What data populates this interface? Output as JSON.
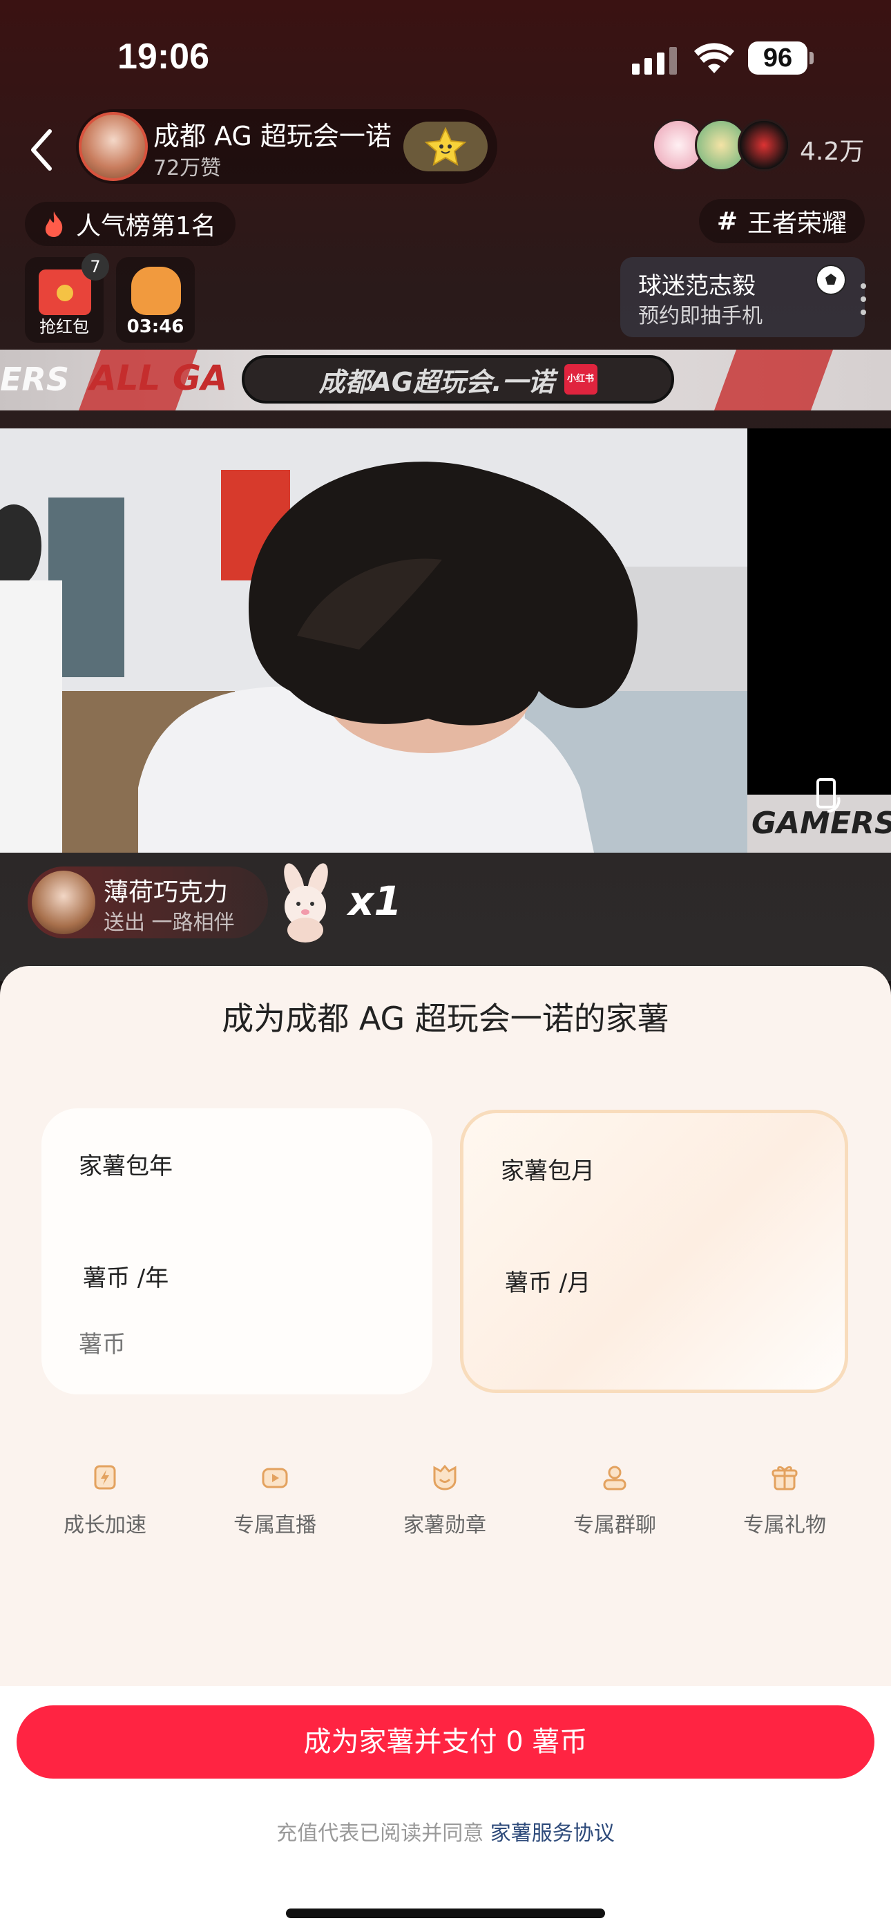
{
  "status": {
    "time": "19:06",
    "battery": "96"
  },
  "header": {
    "host_name": "成都 AG 超玩会一诺",
    "host_likes": "72万赞",
    "viewer_count": "4.2万"
  },
  "badges": {
    "rank": "人气榜第1名",
    "topic_hash": "#",
    "topic": "王者荣耀"
  },
  "widgets": {
    "redpack_label": "抢红包",
    "redpack_count": "7",
    "bag_timer": "03:46",
    "promo_title": "球迷范志毅",
    "promo_sub": "预约即抽手机"
  },
  "banner": {
    "title": "成都AG超玩会.一诺",
    "logo": "小红书",
    "side_left": "ERS",
    "side_right": "ALL GA"
  },
  "video": {
    "watermark": "GAMERS"
  },
  "gift": {
    "user": "薄荷巧克力",
    "action": "送出 一路相伴",
    "count": "x1"
  },
  "sheet": {
    "title": "成为成都 AG 超玩会一诺的家薯",
    "plans": [
      {
        "name": "家薯包年",
        "price": "薯币 /年",
        "sub": "薯币"
      },
      {
        "name": "家薯包月",
        "price": "薯币 /月",
        "sub": ""
      }
    ],
    "benefits": [
      {
        "label": "成长加速",
        "icon": "bolt-icon"
      },
      {
        "label": "专属直播",
        "icon": "play-icon"
      },
      {
        "label": "家薯勋章",
        "icon": "medal-icon"
      },
      {
        "label": "专属群聊",
        "icon": "group-icon"
      },
      {
        "label": "专属礼物",
        "icon": "gift-icon"
      }
    ],
    "pay_button": "成为家薯并支付 0 薯币",
    "agree_text": "充值代表已阅读并同意",
    "agree_link": "家薯服务协议"
  },
  "colors": {
    "accent": "#ff2442",
    "sheet_bg": "#fbf3ee",
    "benefit_icon": "#e3a25f"
  }
}
